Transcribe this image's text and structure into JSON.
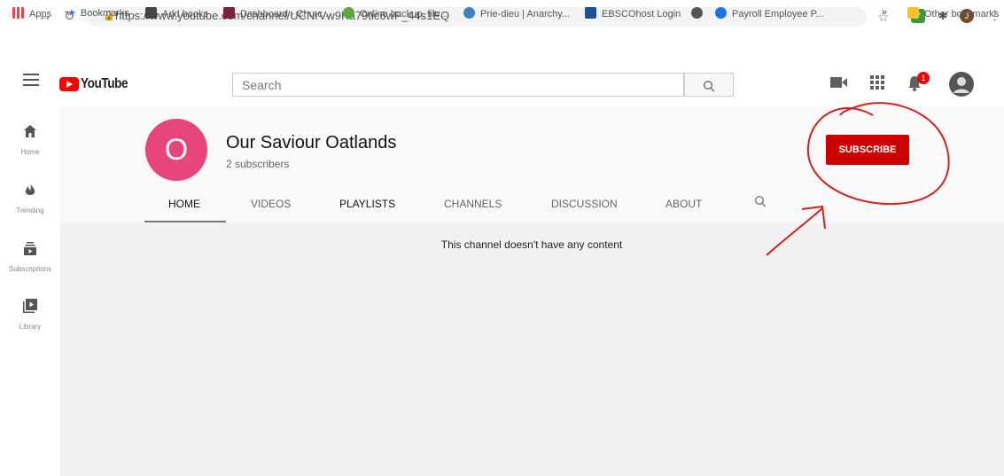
{
  "browser": {
    "url": "https://www.youtube.com/channel/UCNrVw9Ka79tic6wF_44s1EQ",
    "bookmarks": [
      {
        "label": "Apps",
        "color": "#e44"
      },
      {
        "label": "Bookmarks",
        "color": "#1a73e8"
      },
      {
        "label": "Add books",
        "color": "#444"
      },
      {
        "label": "Dashboard - Churc...",
        "color": "#7a1f3d"
      },
      {
        "label": "Online backup, file...",
        "color": "#5aa83a"
      },
      {
        "label": "Prie-dieu | Anarchy...",
        "color": "#3f7fbf"
      },
      {
        "label": "EBSCOhost Login",
        "color": "#1d4f91"
      },
      {
        "label": "",
        "color": "#555"
      },
      {
        "label": "Payroll Employee P...",
        "color": "#1a73e8"
      }
    ],
    "more_label": "»",
    "other_bookmarks": "Other bookmarks"
  },
  "header": {
    "logo_text": "YouTube",
    "search_placeholder": "Search",
    "notification_count": "1"
  },
  "sidebar": {
    "items": [
      {
        "label": "Home",
        "icon": "home-icon"
      },
      {
        "label": "Trending",
        "icon": "trending-icon"
      },
      {
        "label": "Subscriptions",
        "icon": "subscriptions-icon"
      },
      {
        "label": "Library",
        "icon": "library-icon"
      }
    ]
  },
  "channel": {
    "avatar_letter": "O",
    "name": "Our Saviour Oatlands",
    "subscribers": "2 subscribers",
    "subscribe_label": "SUBSCRIBE",
    "tabs": [
      "HOME",
      "VIDEOS",
      "PLAYLISTS",
      "CHANNELS",
      "DISCUSSION",
      "ABOUT"
    ],
    "empty_message": "This channel doesn't have any content"
  },
  "colors": {
    "brand": "#ff0000",
    "subscribe": "#cc0000",
    "avatar": "#e8457a",
    "annotation": "#d62020"
  }
}
